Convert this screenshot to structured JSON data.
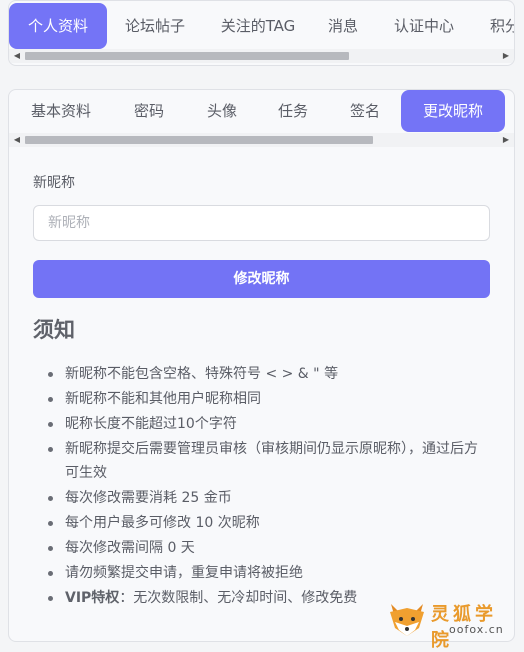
{
  "top_tabs": [
    "个人资料",
    "论坛帖子",
    "关注的TAG",
    "消息",
    "认证中心",
    "积分"
  ],
  "top_active": 0,
  "sub_tabs": [
    "基本资料",
    "密码",
    "头像",
    "任务",
    "签名",
    "更改昵称"
  ],
  "sub_active": 5,
  "form": {
    "label": "新昵称",
    "placeholder": "新昵称",
    "submit": "修改昵称"
  },
  "notice": {
    "title": "须知",
    "rules": [
      "新昵称不能包含空格、特殊符号 < > & \" 等",
      "新昵称不能和其他用户昵称相同",
      "昵称长度不能超过10个字符",
      "新昵称提交后需要管理员审核（审核期间仍显示原昵称），通过后方可生效",
      "每次修改需要消耗 25 金币",
      "每个用户最多可修改 10 次昵称",
      "每次修改需间隔 0 天",
      "请勿频繁提交申请，重复申请将被拒绝"
    ],
    "vip_label": "VIP特权",
    "vip_text": "：无次数限制、无冷却时间、修改免费"
  },
  "logo": {
    "cn": "灵狐学院",
    "en": "oofox.cn"
  },
  "colors": {
    "accent": "#7474f6",
    "logo": "#e99a2c"
  }
}
